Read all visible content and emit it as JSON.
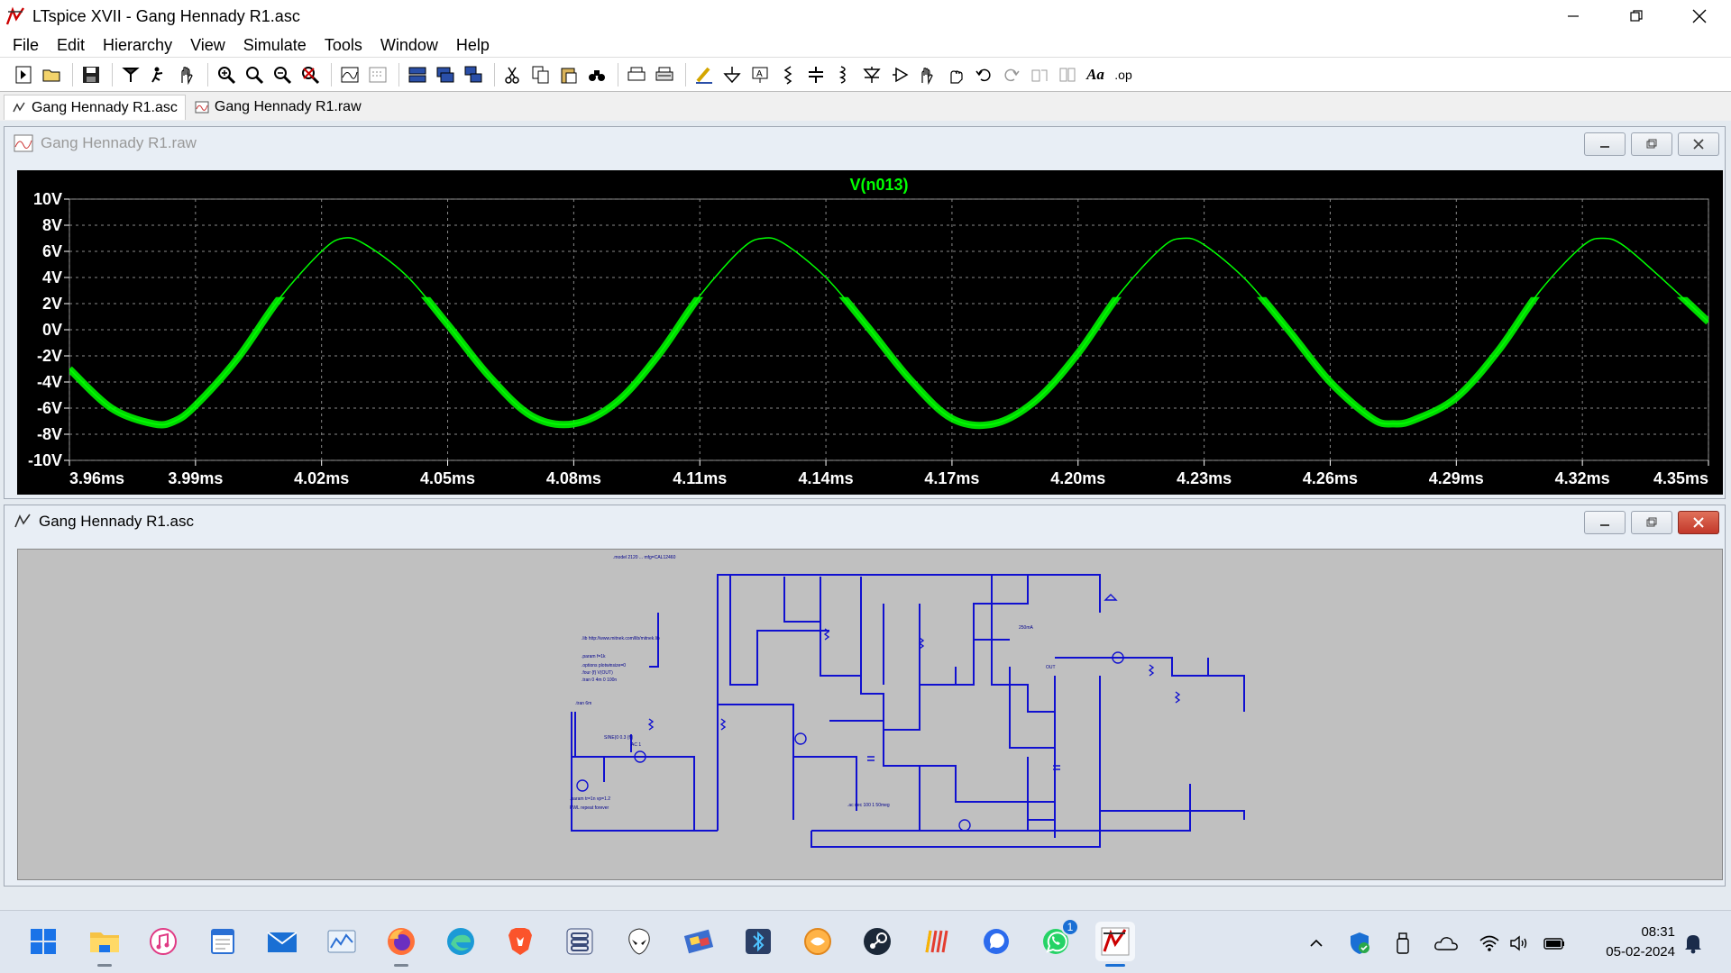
{
  "window": {
    "title": "LTspice XVII - Gang Hennady R1.asc",
    "controls": [
      "minimize-icon",
      "restore-icon",
      "close-icon"
    ]
  },
  "menu": [
    "File",
    "Edit",
    "Hierarchy",
    "View",
    "Simulate",
    "Tools",
    "Window",
    "Help"
  ],
  "toolbar_icons": [
    "new-schematic-icon",
    "open-icon",
    "save-icon",
    "control-panel-icon",
    "run-icon",
    "halt-icon",
    "zoom-in-icon",
    "zoom-out-icon",
    "zoom-fit-icon",
    "zoom-cancel-icon",
    "autorange-icon",
    "mark-unref-icon",
    "tile-horizontal-icon",
    "tile-vertical-icon",
    "cascade-icon",
    "cut-icon",
    "copy-icon",
    "paste-icon",
    "find-icon",
    "print-icon",
    "print-setup-icon",
    "draw-wire-icon",
    "ground-icon",
    "label-net-icon",
    "resistor-icon",
    "capacitor-icon",
    "inductor-icon",
    "diode-icon",
    "component-icon",
    "move-icon",
    "drag-icon",
    "undo-icon",
    "redo-icon",
    "rotate-icon",
    "mirror-icon",
    "text-icon",
    "spice-directive-icon"
  ],
  "toolbar_text": {
    "text_glyph": "Aa",
    "spice_glyph": ".op"
  },
  "tabs": [
    {
      "label": "Gang Hennady R1.asc",
      "icon": "schematic-icon",
      "active": true
    },
    {
      "label": "Gang Hennady R1.raw",
      "icon": "waveform-icon",
      "active": false
    }
  ],
  "plot_window": {
    "title": "Gang Hennady R1.raw",
    "trace_label": "V(n013)",
    "trace_color": "#00ff00"
  },
  "schematic_window": {
    "title": "Gang Hennady R1.asc",
    "texts": {
      "model": ".model 2120 ... mfg=CAL12460",
      "lib": ".lib http://www.mitnek.com/lib/mitnek.lib",
      "param": ".param f=1k",
      "options": ".options plotwinsize=0",
      "four": ".four {f} V(OUT)",
      "tran": ".tran 0 4m 0 100n",
      "tran2": ".tran 6m",
      "pwl": "PWL repeat forever",
      "param2": ".param tr=1n vp=1.2",
      "ac": ".ac dec 100 1 50meg",
      "sine": "SINE(0 0.3 {f})",
      "ac1": "AC 1",
      "out": "OUT",
      "ma": "250mA"
    }
  },
  "chart_data": {
    "type": "line",
    "title": "V(n013)",
    "xlabel": "",
    "ylabel": "",
    "x_ticks": [
      "3.96ms",
      "3.99ms",
      "4.02ms",
      "4.05ms",
      "4.08ms",
      "4.11ms",
      "4.14ms",
      "4.17ms",
      "4.20ms",
      "4.23ms",
      "4.26ms",
      "4.29ms",
      "4.32ms",
      "4.35ms"
    ],
    "y_ticks": [
      "10V",
      "8V",
      "6V",
      "4V",
      "2V",
      "0V",
      "-2V",
      "-4V",
      "-6V",
      "-8V",
      "-10V"
    ],
    "xlim": [
      3.96,
      4.35
    ],
    "ylim": [
      -10,
      10
    ],
    "grid": true,
    "series": [
      {
        "name": "V(n013)",
        "color": "#00ff00",
        "x": [
          3.96,
          3.97,
          3.98,
          3.985,
          3.99,
          4.0,
          4.01,
          4.02,
          4.025,
          4.03,
          4.04,
          4.05,
          4.06,
          4.07,
          4.08,
          4.09,
          4.1,
          4.11,
          4.12,
          4.125,
          4.13,
          4.14,
          4.15,
          4.16,
          4.17,
          4.18,
          4.19,
          4.2,
          4.21,
          4.22,
          4.225,
          4.23,
          4.24,
          4.25,
          4.26,
          4.27,
          4.275,
          4.28,
          4.29,
          4.3,
          4.31,
          4.32,
          4.325,
          4.33,
          4.34,
          4.35
        ],
        "y": [
          -3.0,
          -6.0,
          -7.2,
          -7.0,
          -5.8,
          -2.2,
          2.4,
          6.0,
          7.0,
          6.6,
          4.2,
          0.4,
          -3.6,
          -6.6,
          -7.2,
          -5.6,
          -2.0,
          2.6,
          6.2,
          7.0,
          6.6,
          4.0,
          0.2,
          -3.8,
          -6.8,
          -7.2,
          -5.4,
          -1.8,
          2.8,
          6.3,
          7.0,
          6.5,
          3.8,
          0.0,
          -4.0,
          -6.8,
          -7.2,
          -6.9,
          -5.2,
          -1.6,
          3.0,
          6.4,
          7.0,
          6.4,
          3.6,
          0.6
        ]
      }
    ]
  },
  "taskbar": {
    "apps": [
      "start-icon",
      "file-explorer-icon",
      "itunes-icon",
      "notepad-icon",
      "mail-icon",
      "stocks-icon",
      "firefox-icon",
      "edge-icon",
      "brave-icon",
      "app-stack-icon",
      "alien-icon",
      "tools-icon",
      "bluetooth-icon",
      "app-circle-icon",
      "steam-icon",
      "music-bars-icon",
      "signal-icon",
      "whatsapp-icon",
      "ltspice-icon"
    ],
    "whatsapp_badge": "1",
    "tray_icons": [
      "chevron-up-icon",
      "defender-icon",
      "usb-icon",
      "onedrive-icon",
      "wifi-icon",
      "volume-icon",
      "battery-icon"
    ],
    "time": "08:31",
    "date": "05-02-2024",
    "notification_icon": "bell-icon"
  }
}
